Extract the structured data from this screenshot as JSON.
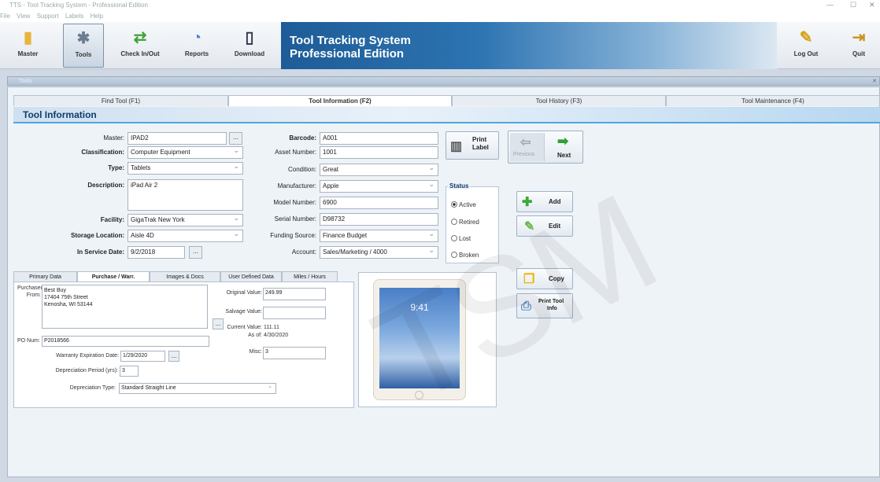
{
  "window": {
    "title": "TTS - Tool Tracking System - Professional Edition",
    "menu": [
      "File",
      "View",
      "Support",
      "Labels",
      "Help"
    ]
  },
  "toolbar": {
    "buttons": [
      "Master",
      "Tools",
      "Check In/Out",
      "Reports",
      "Download",
      "Log Out",
      "Quit"
    ],
    "active": "Tools",
    "icons": [
      "folder-icon",
      "tools-icon",
      "swap-arrows-icon",
      "pie-chart-icon",
      "mobile-device-icon",
      "broom-icon",
      "exit-icon"
    ]
  },
  "brand": {
    "line1": "Tool Tracking System",
    "line2": "Professional Edition"
  },
  "doc_tab": "Tools",
  "tabs": {
    "items": [
      "Find Tool (F1)",
      "Tool Information (F2)",
      "Tool History (F3)",
      "Tool Maintenance (F4)"
    ],
    "active": 1
  },
  "section_title": "Tool Information",
  "form": {
    "master_label": "Master:",
    "master_value": "IPAD2",
    "classification_label": "Classification:",
    "classification_value": "Computer Equipment",
    "type_label": "Type:",
    "type_value": "Tablets",
    "description_label": "Description:",
    "description_value": "iPad Air 2",
    "facility_label": "Facility:",
    "facility_value": "GigaTrak New York",
    "storage_label": "Storage Location:",
    "storage_value": "Aisle 4D",
    "inservice_label": "In Service Date:",
    "inservice_value": "9/2/2018",
    "barcode_label": "Barcode:",
    "barcode_value": "A001",
    "asset_label": "Asset Number:",
    "asset_value": "1001",
    "condition_label": "Condition:",
    "condition_value": "Great",
    "manufacturer_label": "Manufacturer:",
    "manufacturer_value": "Apple",
    "model_label": "Model Number:",
    "model_value": "6900",
    "serial_label": "Serial Number:",
    "serial_value": "D98732",
    "funding_label": "Funding Source:",
    "funding_value": "Finance Budget",
    "account_label": "Account:",
    "account_value": "Sales/Marketing / 4000",
    "ellipsis": "..."
  },
  "print_label": {
    "line1": "Print",
    "line2": "Label"
  },
  "status": {
    "title": "Status",
    "options": [
      "Active",
      "Retired",
      "Lost",
      "Broken"
    ],
    "selected": "Active"
  },
  "nav": {
    "previous": "Previous",
    "next": "Next"
  },
  "actions": {
    "add": "Add",
    "edit": "Edit",
    "copy": "Copy",
    "print_tool_1": "Print Tool",
    "print_tool_2": "Info"
  },
  "subtabs": {
    "items": [
      "Primary Data",
      "Purchase / Warr.",
      "Images & Docs",
      "User Defined Data",
      "Miles / Hours"
    ],
    "active": 1
  },
  "purchase": {
    "from_label_1": "Purchased",
    "from_label_2": "From:",
    "from_lines": [
      "Best Buy",
      "17404 75th Street",
      "Kenosha, WI 53144"
    ],
    "po_label": "PO Num:",
    "po_value": "P2018566",
    "warranty_label": "Warranty Expiration Date:",
    "warranty_value": "1/29/2020",
    "dep_period_label": "Depreciation Period (yrs):",
    "dep_period_value": "3",
    "dep_type_label": "Depreciation Type:",
    "dep_type_value": "Standard Straight Line",
    "original_label": "Original Value:",
    "original_value": "249.99",
    "salvage_label": "Salvage Value:",
    "salvage_value": "",
    "current_label": "Current Value:",
    "current_value": "111.11",
    "asof_label": "As of:",
    "asof_value": "4/30/2020",
    "misc_label": "Misc:",
    "misc_value": "3"
  },
  "photo": {
    "clock": "9:41"
  },
  "watermark": "TSM"
}
